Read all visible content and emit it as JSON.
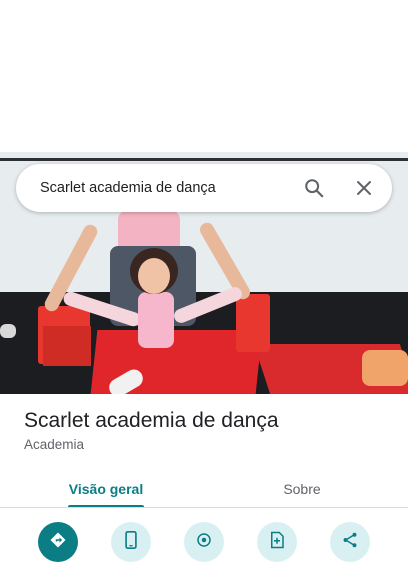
{
  "search": {
    "query": "Scarlet academia de dança"
  },
  "place": {
    "name": "Scarlet academia de dança",
    "category": "Academia"
  },
  "tabs": [
    {
      "label": "Visão geral",
      "active": true
    },
    {
      "label": "Sobre",
      "active": false
    }
  ],
  "actions": [
    {
      "icon": "directions-icon",
      "primary": true
    },
    {
      "icon": "phone-icon",
      "primary": false
    },
    {
      "icon": "location-icon",
      "primary": false
    },
    {
      "icon": "save-icon",
      "primary": false
    },
    {
      "icon": "share-icon",
      "primary": false
    }
  ],
  "colors": {
    "accent": "#0b7d85",
    "accent_light": "#d9f0f2",
    "text": "#202124",
    "muted": "#5f6368"
  }
}
